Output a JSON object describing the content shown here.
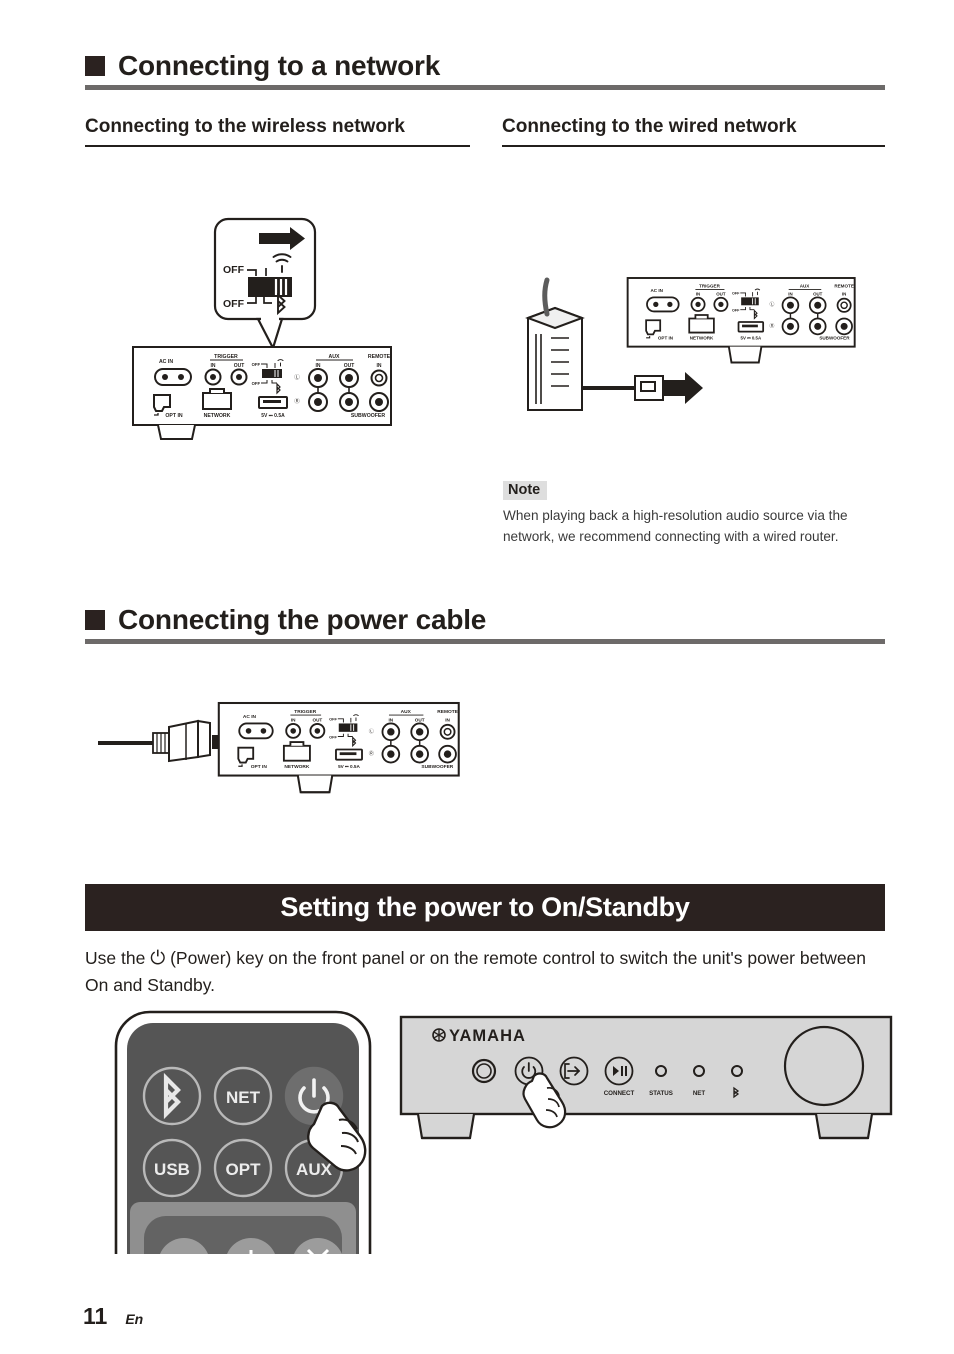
{
  "page": {
    "number": "11",
    "lang_code": "En"
  },
  "section_network": {
    "heading": "Connecting to a network",
    "wireless": {
      "heading": "Connecting to the wireless network",
      "callout": {
        "off_upper": "OFF",
        "off_lower": "OFF",
        "wifi_icon": "wifi-icon",
        "bluetooth_icon": "bluetooth-icon",
        "arrow_icon": "right-arrow-icon"
      }
    },
    "wired": {
      "heading": "Connecting to the wired network",
      "note": {
        "label": "Note",
        "text": "When playing back a high-resolution audio source via the network, we recommend connecting with a wired router."
      }
    }
  },
  "section_power_cable": {
    "heading": "Connecting the power cable"
  },
  "section_standby": {
    "banner": "Setting the power to On/Standby",
    "paragraph_before": "Use the",
    "power_symbol": "⏻",
    "paragraph_after": "(Power) key on the front panel or on the remote control to switch the unit's power between On and Standby."
  },
  "rear_panel": {
    "labels": {
      "ac_in": "AC IN",
      "trigger": "TRIGGER",
      "trigger_in": "IN",
      "trigger_out": "OUT",
      "switch_off_top": "OFF",
      "switch_off_bottom": "OFF",
      "aux": "AUX",
      "aux_in": "IN",
      "aux_out": "OUT",
      "remote": "REMOTE",
      "remote_in": "IN",
      "opt_in": "OPT IN",
      "network": "NETWORK",
      "usb_power": "5V ⏚ 0.5A",
      "subwoofer": "SUBWOOFER",
      "channel_left": "L",
      "channel_right": "R"
    }
  },
  "remote_control": {
    "buttons": [
      {
        "label": "",
        "icon": "bluetooth-icon",
        "name": "bluetooth-button"
      },
      {
        "label": "NET",
        "icon": "",
        "name": "net-button"
      },
      {
        "label": "",
        "icon": "power-icon",
        "name": "power-button"
      },
      {
        "label": "USB",
        "icon": "",
        "name": "usb-button"
      },
      {
        "label": "OPT",
        "icon": "",
        "name": "opt-button"
      },
      {
        "label": "AUX",
        "icon": "",
        "name": "aux-button"
      }
    ]
  },
  "front_panel": {
    "brand": "YAMAHA",
    "indicators": [
      "CONNECT",
      "STATUS",
      "NET",
      ""
    ],
    "bluetooth_indicator_icon": "bluetooth-icon",
    "power_button_icon": "power-icon",
    "input_button_icon": "input-select-icon",
    "play_pause_icon": "play-pause-icon"
  },
  "colors": {
    "ink": "#231f1c",
    "banner_bg": "#2b2220",
    "rule_gray": "#6d6a69",
    "note_tag_bg": "#dedede",
    "panel_fill": "#d6d6d6",
    "remote_body": "#4f4f4f"
  }
}
